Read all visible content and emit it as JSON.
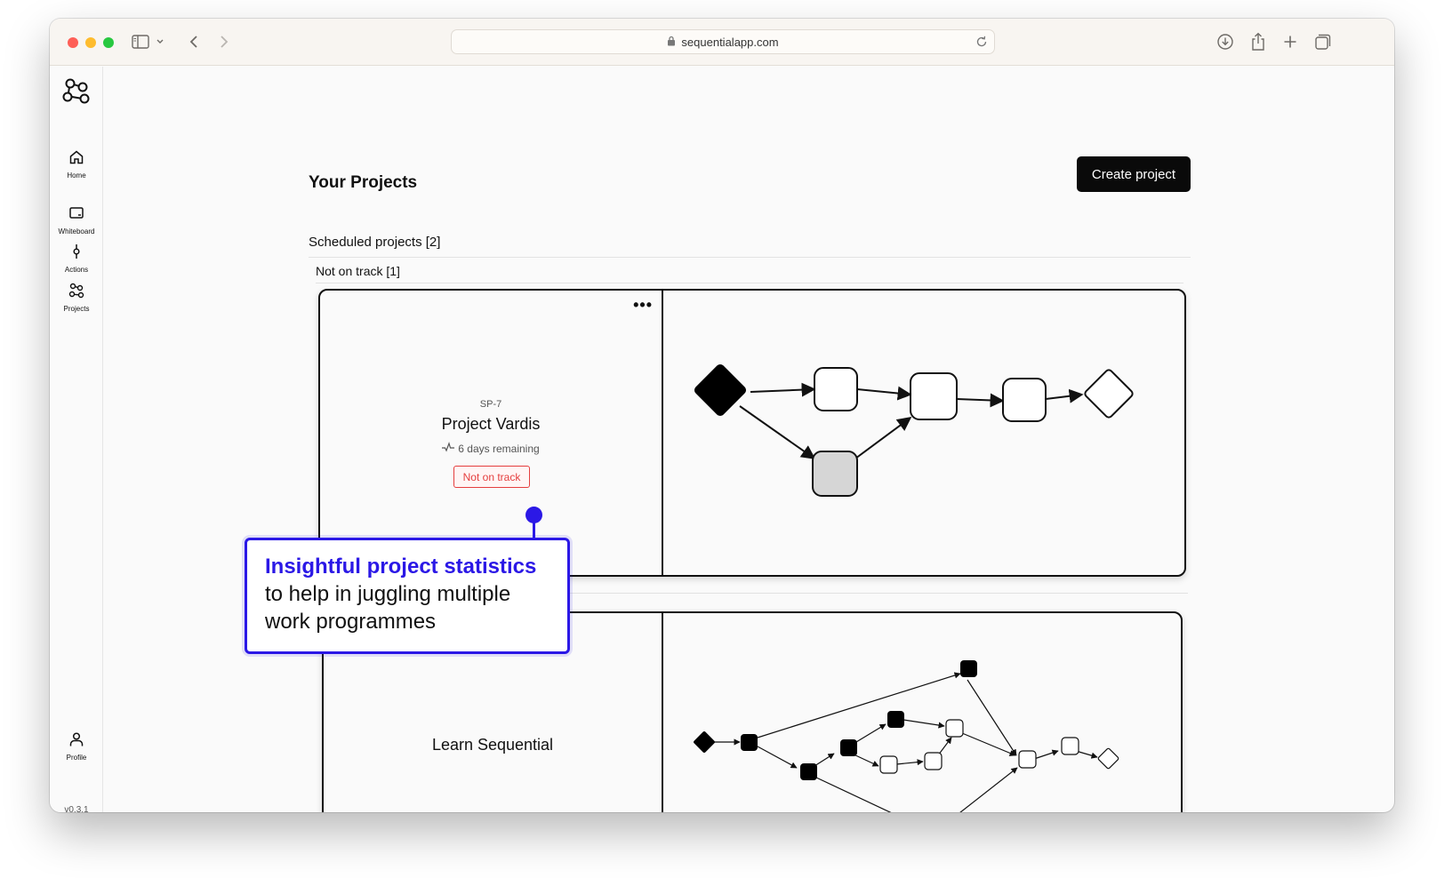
{
  "browser": {
    "url": "sequentialapp.com"
  },
  "sidebar": {
    "items": [
      {
        "label": "Home",
        "icon": "home-icon"
      },
      {
        "label": "Whiteboard",
        "icon": "whiteboard-icon"
      },
      {
        "label": "Actions",
        "icon": "actions-icon"
      },
      {
        "label": "Projects",
        "icon": "projects-icon"
      }
    ],
    "profile_label": "Profile",
    "version": "v0.3.1"
  },
  "main": {
    "title": "Your Projects",
    "create_button": "Create project",
    "section_title": "Scheduled projects [2]",
    "subsection_title": "Not on track [1]",
    "projects": [
      {
        "code": "SP-7",
        "name": "Project Vardis",
        "remaining": "6 days remaining",
        "status": "Not on track"
      },
      {
        "name": "Learn Sequential"
      }
    ]
  },
  "callout": {
    "headline": "Insightful project statistics",
    "body_line1": "to help in juggling multiple",
    "body_line2": "work programmes"
  },
  "colors": {
    "accent": "#2b18e6",
    "status_red": "#e53e3e",
    "primary_button": "#0a0a0a"
  }
}
